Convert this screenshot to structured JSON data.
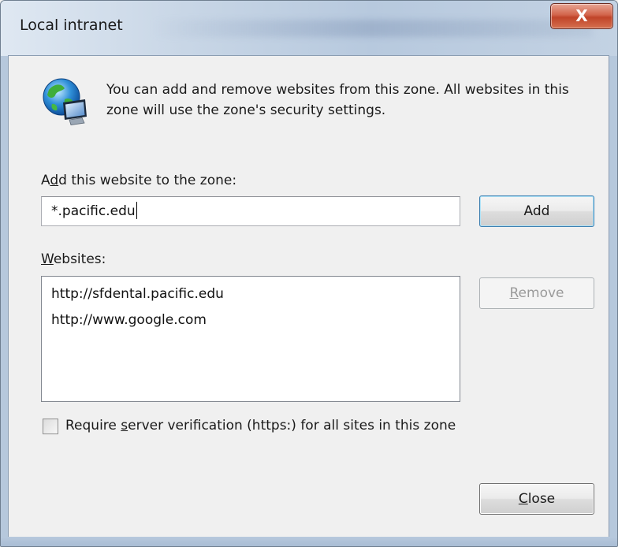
{
  "window": {
    "title": "Local intranet",
    "close_glyph": "X"
  },
  "zone_icon": "globe-computer-icon",
  "intro_text": "You can add and remove websites from this zone. All websites in this zone will use the zone's security settings.",
  "add_section": {
    "label_pre": "A",
    "label_mnemonic": "d",
    "label_post": "d this website to the zone:",
    "input_value": "*.pacific.edu",
    "add_button_label": "Add"
  },
  "websites_section": {
    "label_mnemonic": "W",
    "label_post": "ebsites:",
    "items": [
      "http://sfdental.pacific.edu",
      "http://www.google.com"
    ],
    "remove_button_mnemonic": "R",
    "remove_button_post": "emove"
  },
  "https_checkbox": {
    "checked": false,
    "label_pre": "Require ",
    "label_mnemonic": "s",
    "label_post": "erver verification (https:) for all sites in this zone"
  },
  "footer": {
    "close_button_mnemonic": "C",
    "close_button_post": "lose"
  },
  "colors": {
    "titlebar": "#bccde0",
    "client_bg": "#f0f0f0",
    "close_button_red": "#c04429",
    "default_button_border": "#3c7fb1"
  }
}
